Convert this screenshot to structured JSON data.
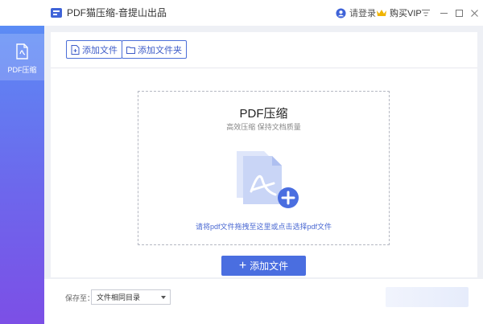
{
  "titlebar": {
    "title": "PDF猫压缩-音提山出品",
    "login_label": "请登录",
    "vip_label": "购买VIP"
  },
  "sidebar": {
    "items": [
      {
        "label": "PDF压缩",
        "icon": "pdf-compress-icon",
        "active": true
      }
    ]
  },
  "toolbar": {
    "add_file_label": "添加文件",
    "add_folder_label": "添加文件夹"
  },
  "dropzone": {
    "title": "PDF压缩",
    "subtitle": "高效压缩 保持文档质量",
    "hint": "请将pdf文件拖拽至这里或点击选择pdf文件",
    "icon": "pdf-file-add-icon"
  },
  "add_button": {
    "label": "添加文件"
  },
  "footer": {
    "save_label": "保存至：",
    "save_location": "文件相同目录"
  },
  "colors": {
    "accent": "#4a6ee0",
    "sidebar_top": "#5b8cf5",
    "sidebar_bottom": "#7c4fe6",
    "vip_gold": "#f0b400"
  }
}
